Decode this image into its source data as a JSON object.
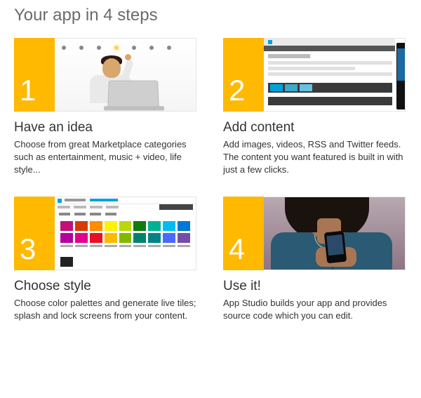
{
  "page": {
    "title": "Your app in 4 steps"
  },
  "steps": [
    {
      "number": "1",
      "title": "Have an idea",
      "description": "Choose from great Marketplace categories such as entertainment, music + video, life style..."
    },
    {
      "number": "2",
      "title": "Add content",
      "description": "Add images, videos, RSS and Twitter feeds. The content you want featured is built in with just a few clicks."
    },
    {
      "number": "3",
      "title": "Choose style",
      "description": "Choose color palettes and generate live tiles; splash and lock screens from your content."
    },
    {
      "number": "4",
      "title": "Use it!",
      "description": "App Studio builds your app and provides source code which you can edit."
    }
  ],
  "colors": {
    "accent": "#ffb900"
  },
  "palette_colors": [
    "#c40f78",
    "#d83b01",
    "#ff8c00",
    "#fff100",
    "#bad80a",
    "#107c10",
    "#00b294",
    "#00bcf2",
    "#0078d7",
    "#b4009e",
    "#e3008c",
    "#e81123",
    "#ffb900",
    "#7fba00",
    "#008272",
    "#038387",
    "#4b69ff",
    "#744da9"
  ]
}
